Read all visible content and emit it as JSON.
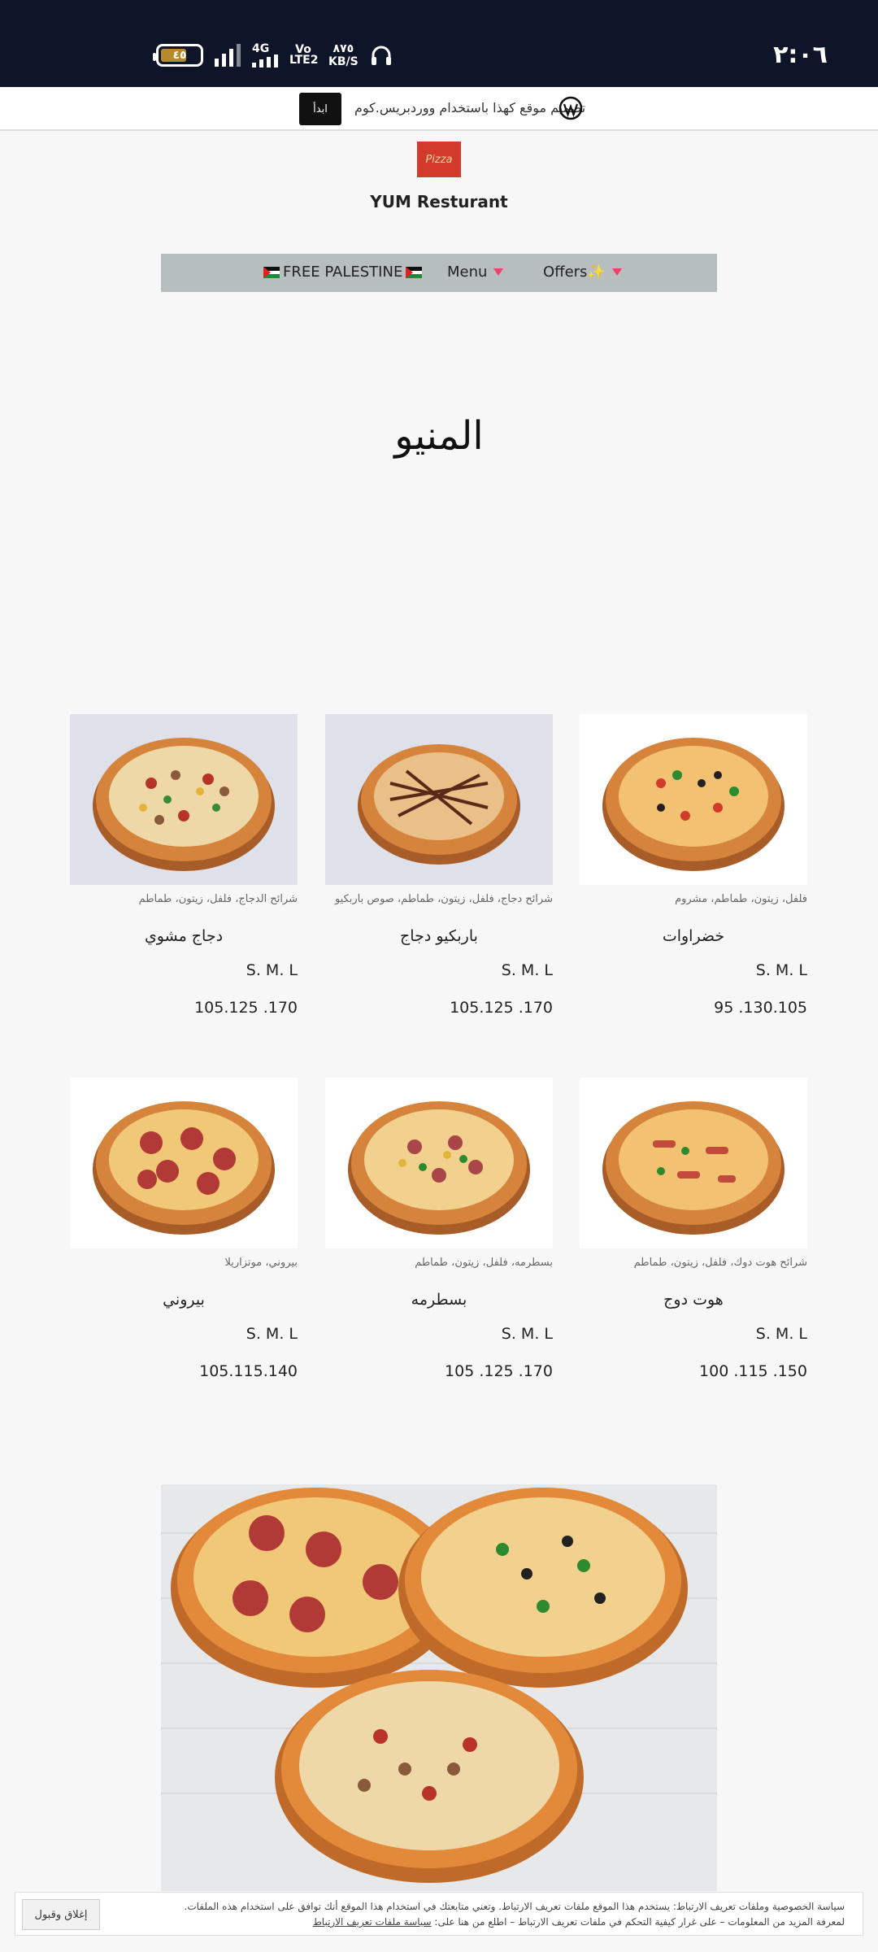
{
  "status_bar": {
    "time": "٢:٠٦",
    "battery": "٤٥",
    "network": "4G",
    "volte": "Vo LTE2",
    "speed_value": "٨٧٥",
    "speed_unit": "KB/S"
  },
  "wp_banner": {
    "text": "تصميم موقع كهذا باستخدام ووردبريس.كوم",
    "button": "ابدأ"
  },
  "header": {
    "logo_text": "Pizza",
    "site_title": "YUM Resturant"
  },
  "nav": {
    "items": [
      {
        "label": "FREE PALESTINE"
      },
      {
        "label": "Menu"
      },
      {
        "label": "Offers✨"
      }
    ]
  },
  "page_heading": "المنيو",
  "menu": [
    {
      "name": "دجاج مشوي",
      "desc": "شرائح الدجاج، فلفل، زيتون، طماطم",
      "sizes": "S. M. L",
      "prices": "105.125 .170",
      "image": "grilled-chicken-pizza"
    },
    {
      "name": "باربكيو دجاج",
      "desc": "شرائح دجاج، فلفل، زيتون، طماطم، صوص باربكيو",
      "sizes": "S. M. L",
      "prices": "105.125 .170",
      "image": "bbq-chicken-pizza"
    },
    {
      "name": "خضراوات",
      "desc": "فلفل، زيتون، طماطم، مشروم",
      "sizes": "S. M. L",
      "prices": "95 .130.105",
      "image": "vegetable-pizza"
    },
    {
      "name": "بيروني",
      "desc": "بيروني، موتزاريلا",
      "sizes": "S. M. L",
      "prices": "105.115.140",
      "image": "pepperoni-pizza"
    },
    {
      "name": "بسطرمه",
      "desc": "بسطرمه، فلفل، زيتون، طماطم",
      "sizes": "S. M. L",
      "prices": "105 .125 .170",
      "image": "pastrami-pizza"
    },
    {
      "name": "هوت دوج",
      "desc": "شرائح هوت دوك، فلفل، زيتون، طماطم",
      "sizes": "S. M. L",
      "prices": "100 .115 .150",
      "image": "hotdog-pizza"
    }
  ],
  "cookie": {
    "line1": "سياسة الخصوصية وملفات تعريف الارتباط: يستخدم هذا الموقع ملفات تعريف الارتباط. وتعني متابعتك في استخدام هذا الموقع أنك توافق على استخدام هذه الملفات.",
    "line2": "لمعرفة المزيد من المعلومات – على غرار كيفية التحكم في ملفات تعريف الارتباط – اطلع من هنا على:",
    "link": "سياسة ملفات تعريف الارتباط",
    "button": "إغلاق وقبول"
  },
  "colors": {
    "status_bar": "#0e1528",
    "nav_bg": "#b7bebe",
    "logo_bg": "#d33a2c",
    "caret": "#e8456b"
  }
}
